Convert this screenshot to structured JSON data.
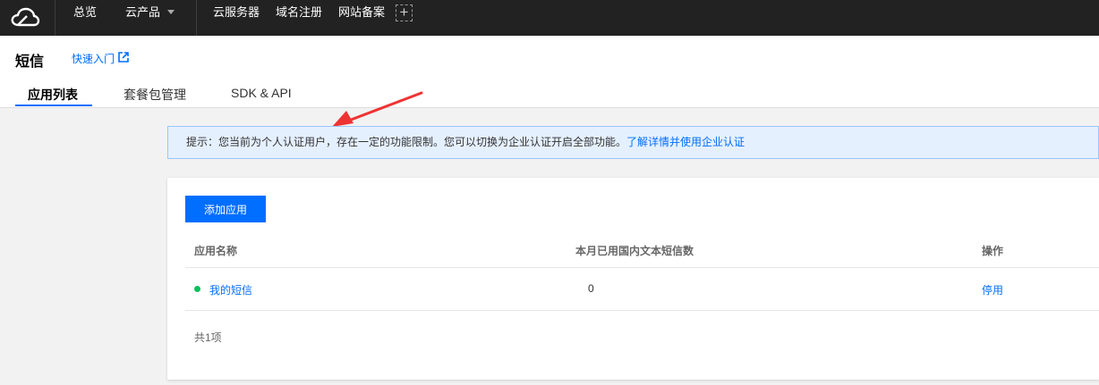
{
  "topnav": {
    "items": [
      {
        "label": "总览"
      },
      {
        "label": "云产品"
      },
      {
        "label": "云服务器"
      },
      {
        "label": "域名注册"
      },
      {
        "label": "网站备案"
      }
    ],
    "add_symbol": "+"
  },
  "header": {
    "title": "短信",
    "quick_start": "快速入门",
    "tabs": [
      {
        "label": "应用列表",
        "active": true
      },
      {
        "label": "套餐包管理"
      },
      {
        "label": "SDK & API"
      }
    ]
  },
  "notice": {
    "text": "提示：您当前为个人认证用户，存在一定的功能限制。您可以切换为企业认证开启全部功能。",
    "link": "了解详情并使用企业认证"
  },
  "card": {
    "add_button": "添加应用",
    "columns": [
      "应用名称",
      "本月已用国内文本短信数",
      "操作"
    ],
    "rows": [
      {
        "name": "我的短信",
        "count": "0",
        "action": "停用",
        "status_color": "#0abf5b"
      }
    ],
    "total": "共1项"
  },
  "colors": {
    "accent": "#006eff",
    "topbar": "#222222",
    "annotation_arrow": "#ee3333"
  }
}
